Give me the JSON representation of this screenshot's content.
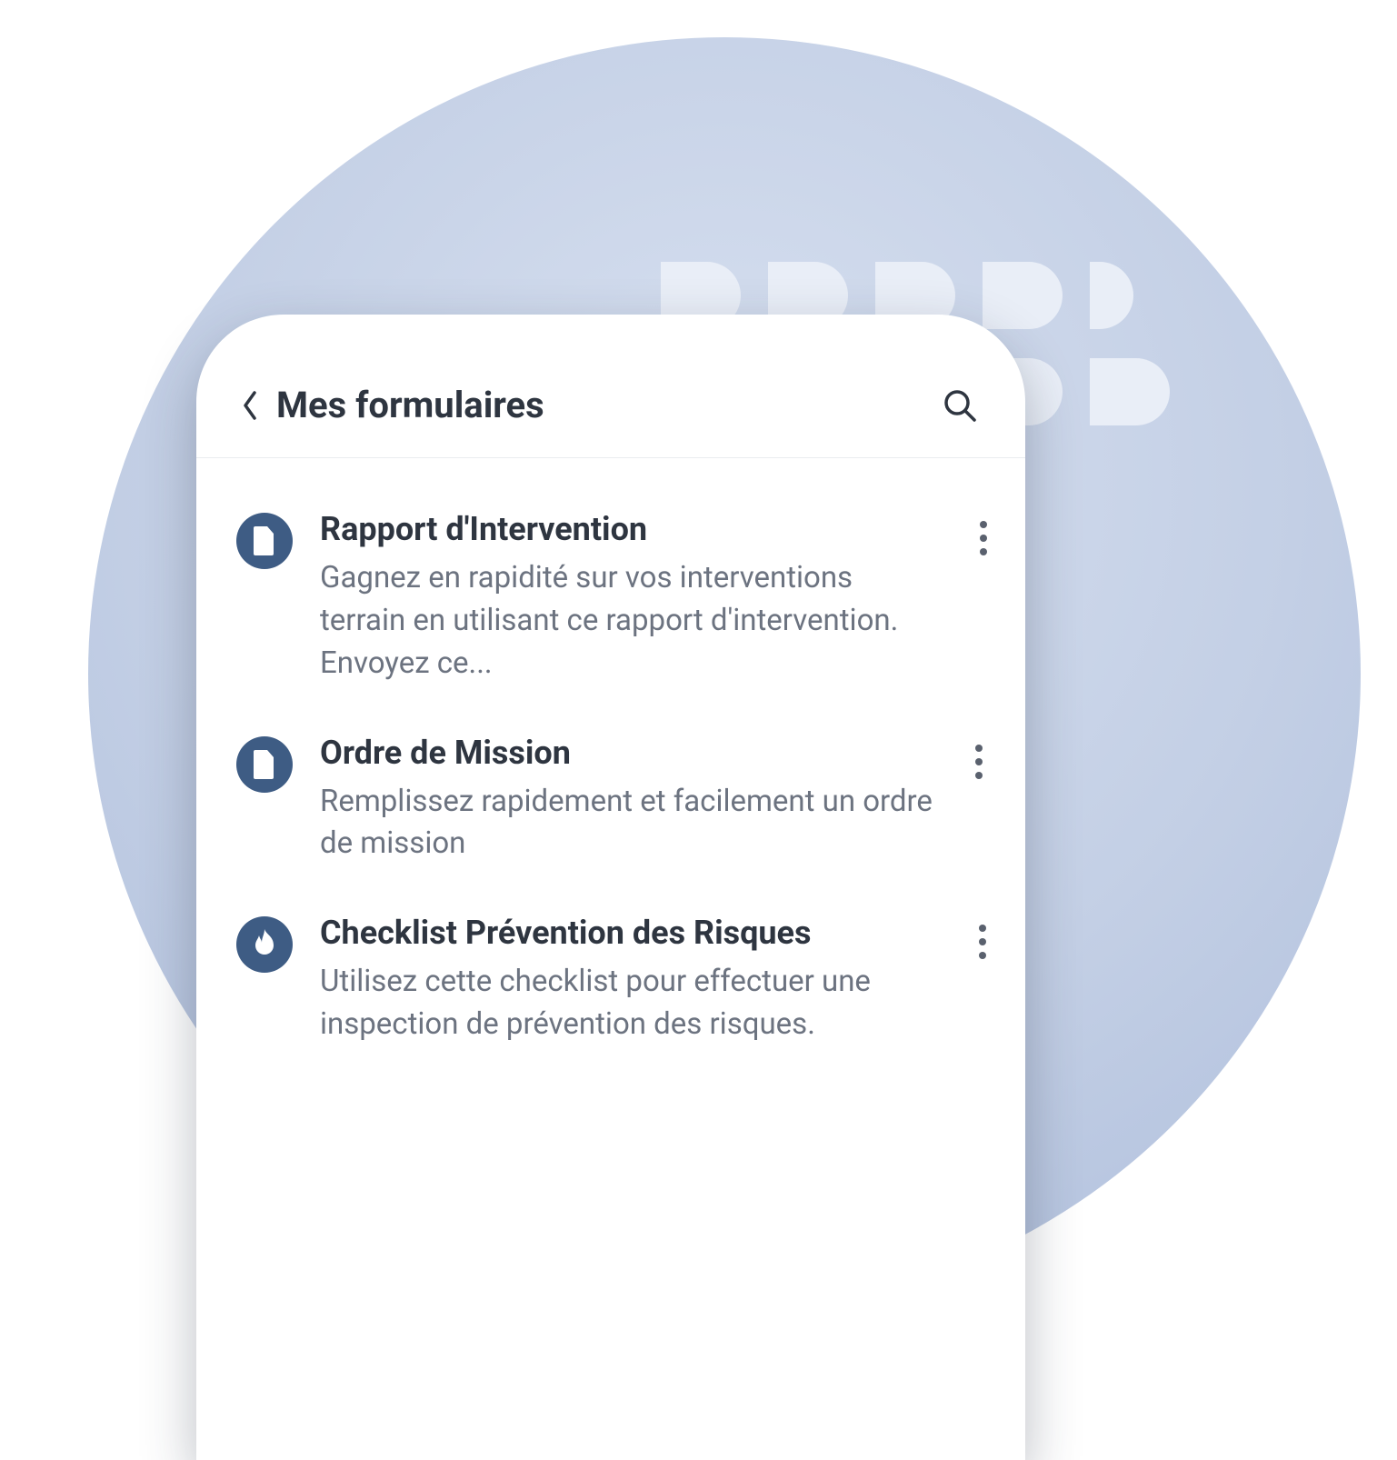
{
  "header": {
    "title": "Mes formulaires"
  },
  "items": [
    {
      "icon": "document",
      "title": "Rapport d'Intervention",
      "desc": "Gagnez en rapidité sur vos interventions terrain en utilisant ce rapport d'intervention. Envoyez ce..."
    },
    {
      "icon": "document",
      "title": "Ordre de Mission",
      "desc": "Remplissez rapidement et facilement un ordre de mission"
    },
    {
      "icon": "fire",
      "title": "Checklist Prévention des Risques",
      "desc": "Utilisez cette checklist pour effectuer une inspection de prévention des risques."
    }
  ],
  "colors": {
    "accent": "#3e5c84"
  }
}
